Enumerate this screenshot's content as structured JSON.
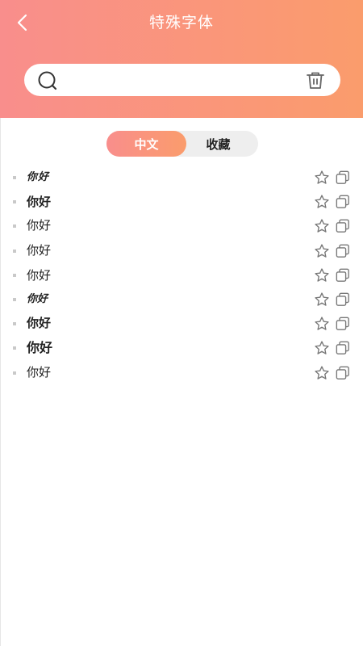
{
  "header": {
    "title": "特殊字体",
    "back_icon": "chevron-left-icon",
    "gradient_start": "#f98e8c",
    "gradient_end": "#fa9c6c"
  },
  "search": {
    "value": "",
    "placeholder": "",
    "search_icon": "search-icon",
    "delete_icon": "trash-icon"
  },
  "tabs": [
    {
      "label": "中文",
      "active": true
    },
    {
      "label": "收藏",
      "active": false
    }
  ],
  "list": {
    "items": [
      {
        "text": "你好",
        "starred": false
      },
      {
        "text": "你好",
        "starred": false
      },
      {
        "text": "你好",
        "starred": false
      },
      {
        "text": "你好",
        "starred": false
      },
      {
        "text": "你好",
        "starred": false
      },
      {
        "text": "你好",
        "starred": false
      },
      {
        "text": "你好",
        "starred": false
      },
      {
        "text": "你好",
        "starred": false
      },
      {
        "text": "你好",
        "starred": false
      }
    ],
    "star_icon": "star-outline-icon",
    "copy_icon": "copy-icon"
  }
}
